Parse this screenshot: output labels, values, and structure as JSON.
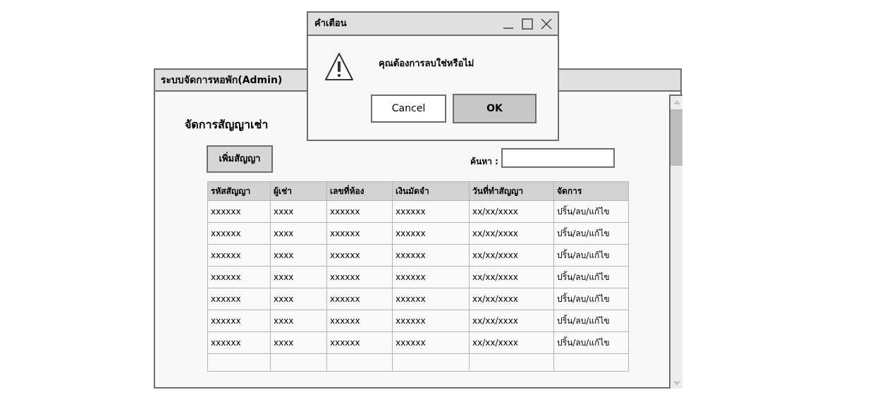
{
  "window": {
    "title": "ระบบจัดการหอพัก(Admin)",
    "page_title": "จัดการสัญญาเช่า",
    "add_button_label": "เพิ่มสัญญา",
    "search_label": "ค้นหา :",
    "search_value": ""
  },
  "table": {
    "headers": [
      "รหัสสัญญา",
      "ผู้เช่า",
      "เลขที่ห้อง",
      "เงินมัดจำ",
      "วันที่ทำสัญญา",
      "จัดการ"
    ],
    "rows": [
      [
        "xxxxxx",
        "xxxx",
        "xxxxxx",
        "xxxxxx",
        "xx/xx/xxxx",
        "ปริ้น/ลบ/แก้ไข"
      ],
      [
        "xxxxxx",
        "xxxx",
        "xxxxxx",
        "xxxxxx",
        "xx/xx/xxxx",
        "ปริ้น/ลบ/แก้ไข"
      ],
      [
        "xxxxxx",
        "xxxx",
        "xxxxxx",
        "xxxxxx",
        "xx/xx/xxxx",
        "ปริ้น/ลบ/แก้ไข"
      ],
      [
        "xxxxxx",
        "xxxx",
        "xxxxxx",
        "xxxxxx",
        "xx/xx/xxxx",
        "ปริ้น/ลบ/แก้ไข"
      ],
      [
        "xxxxxx",
        "xxxx",
        "xxxxxx",
        "xxxxxx",
        "xx/xx/xxxx",
        "ปริ้น/ลบ/แก้ไข"
      ],
      [
        "xxxxxx",
        "xxxx",
        "xxxxxx",
        "xxxxxx",
        "xx/xx/xxxx",
        "ปริ้น/ลบ/แก้ไข"
      ],
      [
        "xxxxxx",
        "xxxx",
        "xxxxxx",
        "xxxxxx",
        "xx/xx/xxxx",
        "ปริ้น/ลบ/แก้ไข"
      ]
    ]
  },
  "dialog": {
    "title": "คำเตือน",
    "message": "คุณต้องการลบใช่หรือไม่",
    "cancel_label": "Cancel",
    "ok_label": "OK",
    "icon": "warning-icon"
  },
  "colors": {
    "border": "#6e6e6e",
    "title_bar": "#e0e0e0",
    "header_bg": "#d2d2d2",
    "ok_bg": "#c8c8c8"
  }
}
